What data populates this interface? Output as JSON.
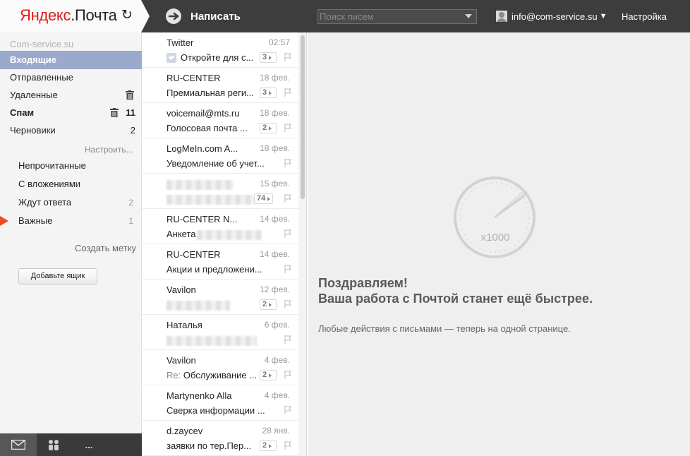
{
  "header": {
    "logo_yandex": "Яндекс",
    "logo_dot": ".",
    "logo_mail": "Почта",
    "compose_label": "Написать",
    "search_placeholder": "Поиск писем",
    "user_email": "info@com-service.su",
    "settings_label": "Настройка"
  },
  "sidebar": {
    "account": "Com-service.su",
    "folders": [
      {
        "label": "Входящие",
        "count": ""
      },
      {
        "label": "Отправленные",
        "count": ""
      },
      {
        "label": "Удаленные",
        "count": ""
      },
      {
        "label": "Спам",
        "count": "11"
      },
      {
        "label": "Черновики",
        "count": "2"
      }
    ],
    "setup_label": "Настроить...",
    "labels": [
      {
        "label": "Непрочитанные",
        "count": ""
      },
      {
        "label": "С вложениями",
        "count": ""
      },
      {
        "label": "Ждут ответа",
        "count": "2"
      },
      {
        "label": "Важные",
        "count": "1"
      }
    ],
    "create_label": "Создать метку",
    "add_box_label": "Добавьте ящик",
    "bottom_more": "..."
  },
  "messages": [
    {
      "from": "Twitter",
      "date": "02:57",
      "subject": "Откройте для с...",
      "count": "3",
      "icon": "twitter-bird-icon"
    },
    {
      "from": "RU-CENTER",
      "date": "18 фев.",
      "subject": "Премиальная реги...",
      "count": "3"
    },
    {
      "from": "voicemail@mts.ru",
      "date": "18 фев.",
      "subject": "Голосовая почта ...",
      "count": "2"
    },
    {
      "from": "LogMeIn.com A...",
      "date": "18 фев.",
      "subject": "Уведомление об учет...",
      "count": ""
    },
    {
      "from": "",
      "date": "15 фев.",
      "subject": "",
      "count": "74"
    },
    {
      "from": "RU-CENTER N...",
      "date": "14 фев.",
      "subject": "Анкета",
      "count": ""
    },
    {
      "from": "RU-CENTER",
      "date": "14 фев.",
      "subject": "Акции и предложени...",
      "count": ""
    },
    {
      "from": "Vavilon",
      "date": "12 фев.",
      "subject": "",
      "count": "2"
    },
    {
      "from": "Наталья",
      "date": "6 фев.",
      "subject": "",
      "count": ""
    },
    {
      "from": "Vavilon",
      "date": "4 фев.",
      "re": "Re:",
      "subject": "Обслуживание ...",
      "count": "2"
    },
    {
      "from": "Martynenko Alla",
      "date": "4 фев.",
      "subject": "Сверка информации ...",
      "count": ""
    },
    {
      "from": "d.zaycev",
      "date": "28 янв.",
      "subject": "заявки по тер.Пер...",
      "count": "2"
    }
  ],
  "promo": {
    "gauge_label": "x1000",
    "title_line1": "Поздравляем!",
    "title_line2": "Ваша работа с Почтой станет ещё быстрее.",
    "subtitle": "Любые действия с письмами — теперь на одной странице."
  },
  "colors": {
    "topbar": "#3d3d3d",
    "active_folder": "#9aa9cc",
    "important_flag": "#f04a21",
    "logo_red": "#e01b1b"
  }
}
